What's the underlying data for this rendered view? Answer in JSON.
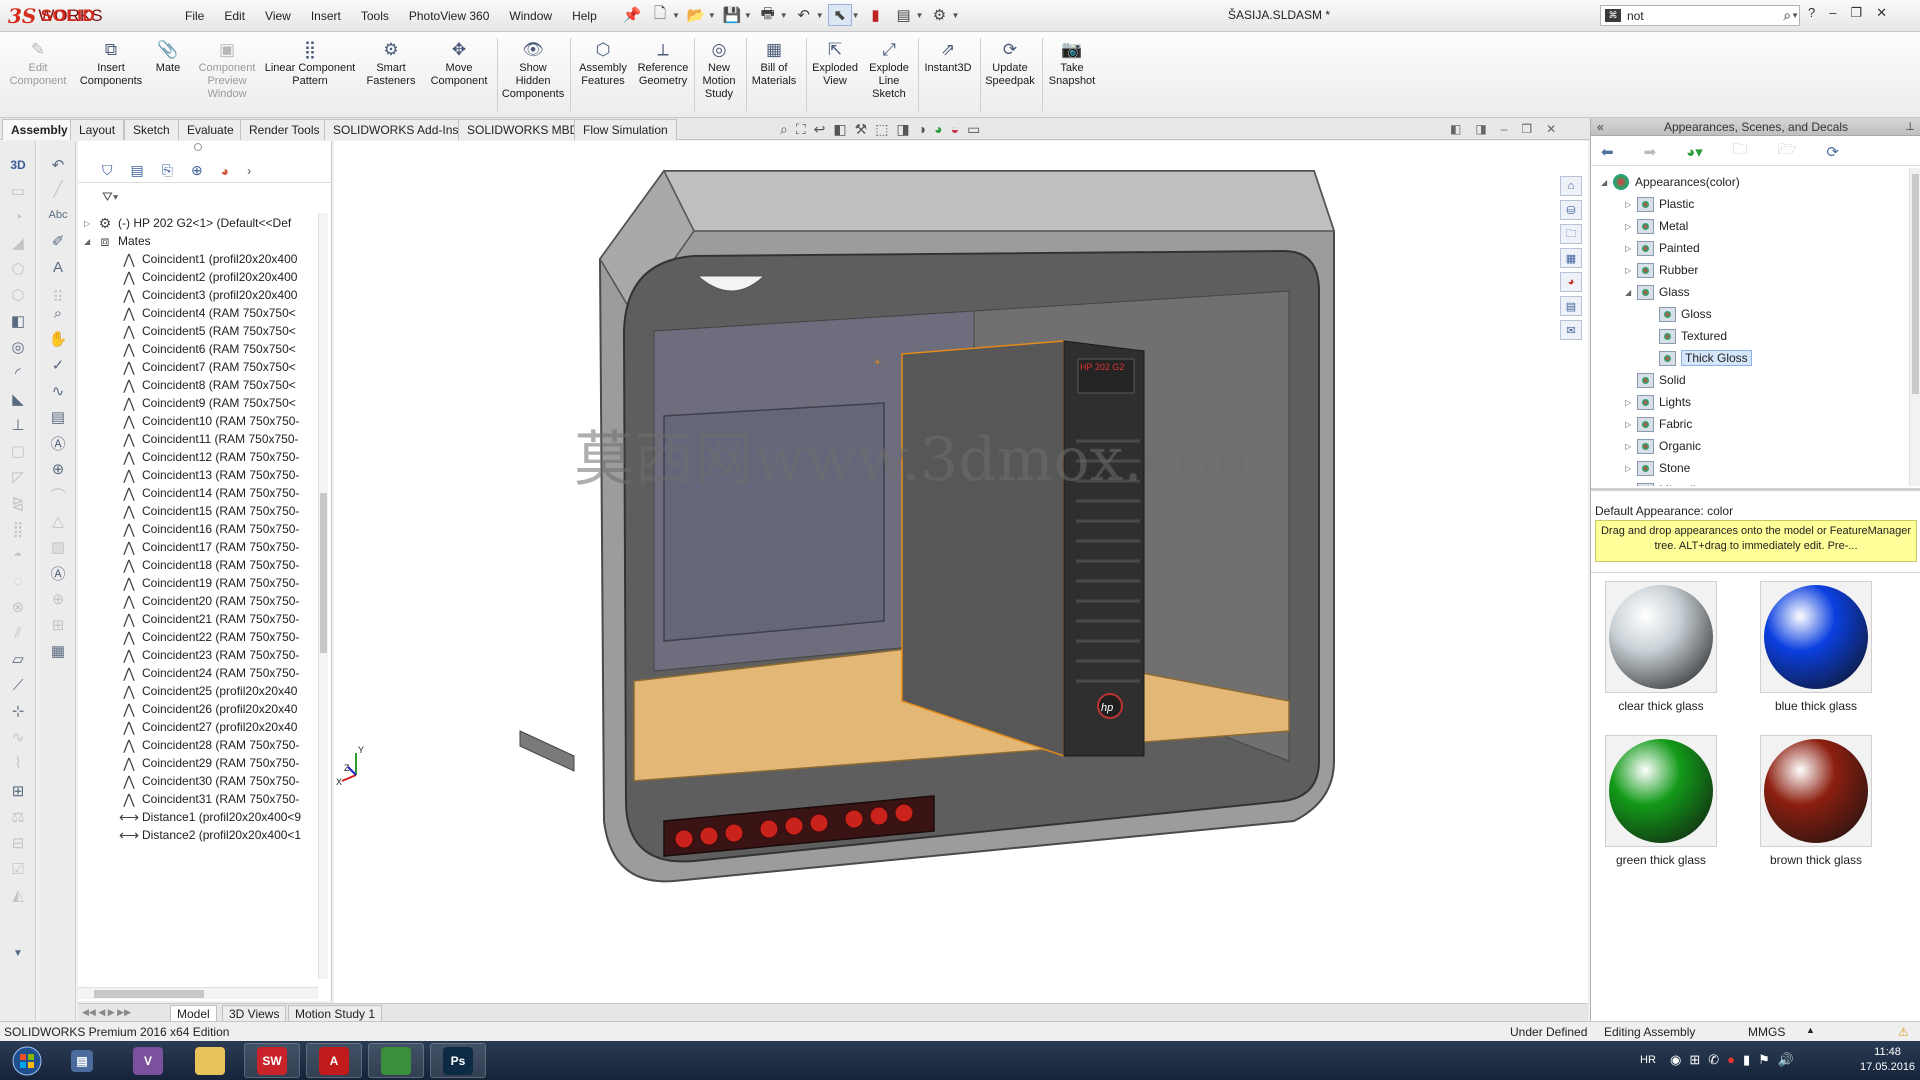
{
  "app": {
    "logo": {
      "ds": "3S",
      "solid": "SOLID",
      "works": "WORKS"
    },
    "menus": [
      "File",
      "Edit",
      "View",
      "Insert",
      "Tools",
      "PhotoView 360",
      "Window",
      "Help"
    ],
    "document_title": "ŠASIJA.SLDASM *",
    "search": {
      "value": "not"
    },
    "window_controls": [
      "?",
      "–",
      "❐",
      "✕"
    ]
  },
  "commands": [
    {
      "label": "Edit Component",
      "icon": "edit-component-icon",
      "disabled": true
    },
    {
      "label": "Insert Components",
      "icon": "insert-components-icon"
    },
    {
      "label": "Mate",
      "icon": "mate-icon"
    },
    {
      "label": "Component Preview Window",
      "icon": "preview-window-icon",
      "disabled": true
    },
    {
      "label": "Linear Component Pattern",
      "icon": "linear-pattern-icon"
    },
    {
      "label": "Smart Fasteners",
      "icon": "smart-fasteners-icon"
    },
    {
      "label": "Move Component",
      "icon": "move-component-icon"
    },
    {
      "label": "Show Hidden Components",
      "icon": "show-hidden-icon"
    },
    {
      "label": "Assembly Features",
      "icon": "assembly-features-icon"
    },
    {
      "label": "Reference Geometry",
      "icon": "reference-geometry-icon"
    },
    {
      "label": "New Motion Study",
      "icon": "motion-study-icon"
    },
    {
      "label": "Bill of Materials",
      "icon": "bom-icon"
    },
    {
      "label": "Exploded View",
      "icon": "exploded-view-icon"
    },
    {
      "label": "Explode Line Sketch",
      "icon": "explode-line-icon"
    },
    {
      "label": "Instant3D",
      "icon": "instant3d-icon"
    },
    {
      "label": "Update Speedpak",
      "icon": "speedpak-icon"
    },
    {
      "label": "Take Snapshot",
      "icon": "snapshot-icon"
    }
  ],
  "tabs": [
    "Assembly",
    "Layout",
    "Sketch",
    "Evaluate",
    "Render Tools",
    "SOLIDWORKS Add-Ins",
    "SOLIDWORKS MBD",
    "Flow Simulation"
  ],
  "active_tab": "Assembly",
  "feature_tree": {
    "root": "(-) HP 202 G2<1> (Default<<Def",
    "mates_label": "Mates",
    "mates": [
      {
        "type": "coincident",
        "label": "Coincident1 (profil20x20x400"
      },
      {
        "type": "coincident",
        "label": "Coincident2 (profil20x20x400"
      },
      {
        "type": "coincident",
        "label": "Coincident3 (profil20x20x400"
      },
      {
        "type": "coincident",
        "label": "Coincident4 (RAM 750x750<"
      },
      {
        "type": "coincident",
        "label": "Coincident5 (RAM 750x750<"
      },
      {
        "type": "coincident",
        "label": "Coincident6 (RAM 750x750<"
      },
      {
        "type": "coincident",
        "label": "Coincident7 (RAM 750x750<"
      },
      {
        "type": "coincident",
        "label": "Coincident8 (RAM 750x750<"
      },
      {
        "type": "coincident",
        "label": "Coincident9 (RAM 750x750<"
      },
      {
        "type": "coincident",
        "label": "Coincident10 (RAM 750x750-"
      },
      {
        "type": "coincident",
        "label": "Coincident11 (RAM 750x750-"
      },
      {
        "type": "coincident",
        "label": "Coincident12 (RAM 750x750-"
      },
      {
        "type": "coincident",
        "label": "Coincident13 (RAM 750x750-"
      },
      {
        "type": "coincident",
        "label": "Coincident14 (RAM 750x750-"
      },
      {
        "type": "coincident",
        "label": "Coincident15 (RAM 750x750-"
      },
      {
        "type": "coincident",
        "label": "Coincident16 (RAM 750x750-"
      },
      {
        "type": "coincident",
        "label": "Coincident17 (RAM 750x750-"
      },
      {
        "type": "coincident",
        "label": "Coincident18 (RAM 750x750-"
      },
      {
        "type": "coincident",
        "label": "Coincident19 (RAM 750x750-"
      },
      {
        "type": "coincident",
        "label": "Coincident20 (RAM 750x750-"
      },
      {
        "type": "coincident",
        "label": "Coincident21 (RAM 750x750-"
      },
      {
        "type": "coincident",
        "label": "Coincident22 (RAM 750x750-"
      },
      {
        "type": "coincident",
        "label": "Coincident23 (RAM 750x750-"
      },
      {
        "type": "coincident",
        "label": "Coincident24 (RAM 750x750-"
      },
      {
        "type": "coincident",
        "label": "Coincident25 (profil20x20x40"
      },
      {
        "type": "coincident",
        "label": "Coincident26 (profil20x20x40"
      },
      {
        "type": "coincident",
        "label": "Coincident27 (profil20x20x40"
      },
      {
        "type": "coincident",
        "label": "Coincident28 (RAM 750x750-"
      },
      {
        "type": "coincident",
        "label": "Coincident29 (RAM 750x750-"
      },
      {
        "type": "coincident",
        "label": "Coincident30 (RAM 750x750-"
      },
      {
        "type": "coincident",
        "label": "Coincident31 (RAM 750x750-"
      },
      {
        "type": "distance",
        "label": "Distance1 (profil20x20x400<9"
      },
      {
        "type": "distance",
        "label": "Distance2 (profil20x20x400<1"
      }
    ]
  },
  "model_tabs": [
    "Model",
    "3D Views",
    "Motion Study 1"
  ],
  "viewport": {
    "watermark": "莫西网www.3dmox.com",
    "pc_badge": "HP 202 G2",
    "pc_logo": "hp",
    "triad": {
      "x": "X",
      "y": "Y",
      "z": "Z"
    }
  },
  "task_pane": {
    "title": "Appearances, Scenes, and Decals",
    "tree_root": "Appearances(color)",
    "tree_items": [
      {
        "label": "Plastic",
        "level": 1,
        "expanded": false
      },
      {
        "label": "Metal",
        "level": 1,
        "expanded": false
      },
      {
        "label": "Painted",
        "level": 1,
        "expanded": false
      },
      {
        "label": "Rubber",
        "level": 1,
        "expanded": false
      },
      {
        "label": "Glass",
        "level": 1,
        "expanded": true
      },
      {
        "label": "Gloss",
        "level": 2
      },
      {
        "label": "Textured",
        "level": 2
      },
      {
        "label": "Thick Gloss",
        "level": 2,
        "selected": true
      },
      {
        "label": "Solid",
        "level": 1
      },
      {
        "label": "Lights",
        "level": 1,
        "expanded": false
      },
      {
        "label": "Fabric",
        "level": 1,
        "expanded": false
      },
      {
        "label": "Organic",
        "level": 1,
        "expanded": false
      },
      {
        "label": "Stone",
        "level": 1,
        "expanded": false
      },
      {
        "label": "Miscellaneous",
        "level": 1,
        "expanded": false
      }
    ],
    "default_appearance": "Default Appearance: color",
    "hint": "Drag and drop appearances onto the model or FeatureManager tree.  ALT+drag to immediately edit.  Pre-...",
    "swatches": [
      {
        "label": "clear thick glass",
        "color": "#c9d1d6"
      },
      {
        "label": "blue thick glass",
        "color": "#0b3fe0",
        "selected": true
      },
      {
        "label": "green thick glass",
        "color": "#139a19"
      },
      {
        "label": "brown thick glass",
        "color": "#8c1f10"
      }
    ]
  },
  "statusbar": {
    "left": "SOLIDWORKS Premium 2016 x64 Edition",
    "state": "Under Defined",
    "mode": "Editing Assembly",
    "units": "MMGS"
  },
  "taskbar": {
    "apps": [
      {
        "name": "viber",
        "label": "V",
        "color": "#7b519d"
      },
      {
        "name": "explorer",
        "label": "",
        "color": "#e8c25a"
      },
      {
        "name": "solidworks",
        "label": "SW",
        "color": "#c8222b"
      },
      {
        "name": "autocad",
        "label": "A",
        "color": "#c01a1a"
      },
      {
        "name": "chrome",
        "label": "",
        "color": "#3b8f3b"
      },
      {
        "name": "photoshop",
        "label": "Ps",
        "color": "#0c2a44"
      }
    ],
    "language": "HR",
    "time": "11:48",
    "date": "17.05.2016"
  }
}
